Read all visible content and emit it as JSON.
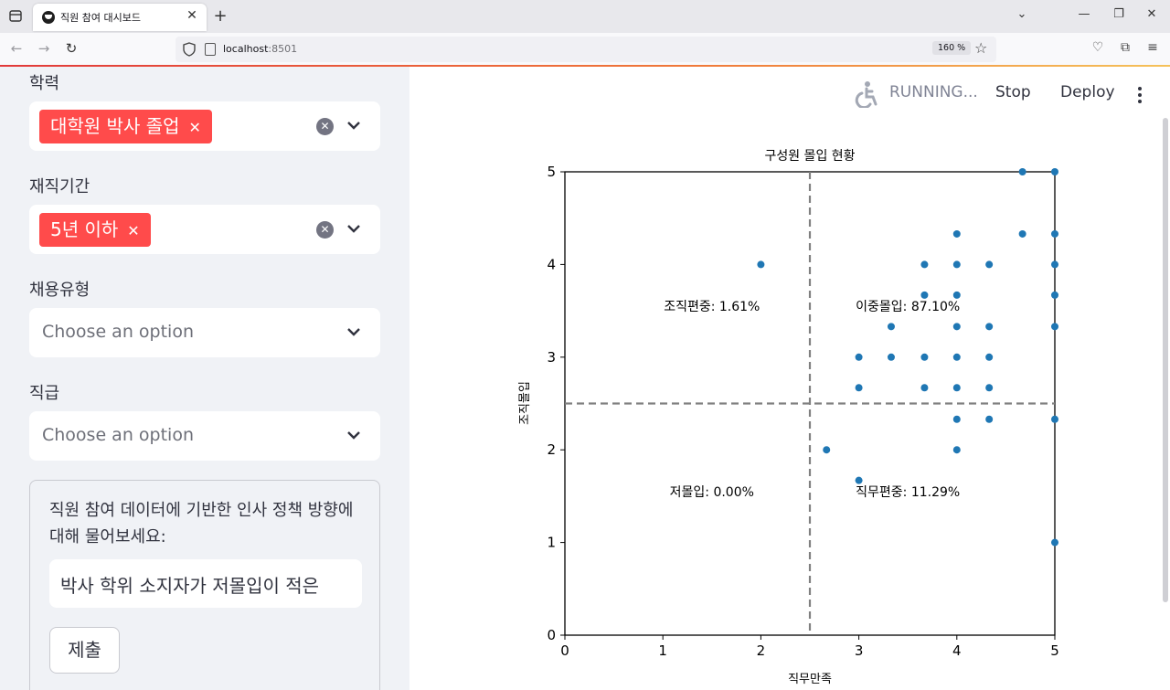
{
  "browser": {
    "tab_title": "직원 참여 대시보드",
    "url_host": "localhost",
    "url_port": ":8501",
    "zoom": "160 %"
  },
  "sidebar": {
    "filters": [
      {
        "label": "학력",
        "selected": "대학원 박사 졸업",
        "placeholder": ""
      },
      {
        "label": "재직기간",
        "selected": "5년 이하",
        "placeholder": ""
      },
      {
        "label": "채용유형",
        "selected": "",
        "placeholder": "Choose an option"
      },
      {
        "label": "직급",
        "selected": "",
        "placeholder": "Choose an option"
      }
    ],
    "form": {
      "question": "직원 참여 데이터에 기반한 인사 정책 방향에 대해 물어보세요:",
      "input_value": "박사 학위 소지자가 저몰입이 적은",
      "submit_label": "제출"
    }
  },
  "header": {
    "status": "RUNNING...",
    "stop_label": "Stop",
    "deploy_label": "Deploy"
  },
  "colors": {
    "accent": "#ff4b4b",
    "point": "#1f77b4",
    "threshold": "#808080"
  },
  "chart_data": {
    "type": "scatter",
    "title": "구성원 몰입 현황",
    "xlabel": "직무만족",
    "ylabel": "조직몰입",
    "xlim": [
      0,
      5
    ],
    "ylim": [
      0,
      5
    ],
    "xticks": [
      0,
      1,
      2,
      3,
      4,
      5
    ],
    "yticks": [
      0,
      1,
      2,
      3,
      4,
      5
    ],
    "thresholds": {
      "x": 2.5,
      "y": 2.5
    },
    "quadrant_labels": [
      {
        "text": "조직편중: 1.61%",
        "x": 1.5,
        "y": 3.55
      },
      {
        "text": "이중몰입: 87.10%",
        "x": 3.5,
        "y": 3.55
      },
      {
        "text": "저몰입: 0.00%",
        "x": 1.5,
        "y": 1.55
      },
      {
        "text": "직무편중: 11.29%",
        "x": 3.5,
        "y": 1.55
      }
    ],
    "points": [
      [
        2,
        4
      ],
      [
        2.67,
        2
      ],
      [
        3,
        1.67
      ],
      [
        3,
        2.67
      ],
      [
        3,
        3
      ],
      [
        3.33,
        3
      ],
      [
        3.33,
        3.33
      ],
      [
        3.67,
        2.67
      ],
      [
        3.67,
        3
      ],
      [
        3.67,
        3.67
      ],
      [
        3.67,
        4
      ],
      [
        4,
        2
      ],
      [
        4,
        2.33
      ],
      [
        4,
        2.67
      ],
      [
        4,
        3
      ],
      [
        4,
        3.33
      ],
      [
        4,
        3.67
      ],
      [
        4,
        4
      ],
      [
        4,
        4.33
      ],
      [
        4.33,
        2.33
      ],
      [
        4.33,
        2.67
      ],
      [
        4.33,
        3
      ],
      [
        4.33,
        3.33
      ],
      [
        4.33,
        4
      ],
      [
        4.67,
        4.33
      ],
      [
        4.67,
        5
      ],
      [
        5,
        1
      ],
      [
        5,
        2.33
      ],
      [
        5,
        3.33
      ],
      [
        5,
        3.67
      ],
      [
        5,
        4
      ],
      [
        5,
        4.33
      ],
      [
        5,
        5
      ]
    ]
  }
}
